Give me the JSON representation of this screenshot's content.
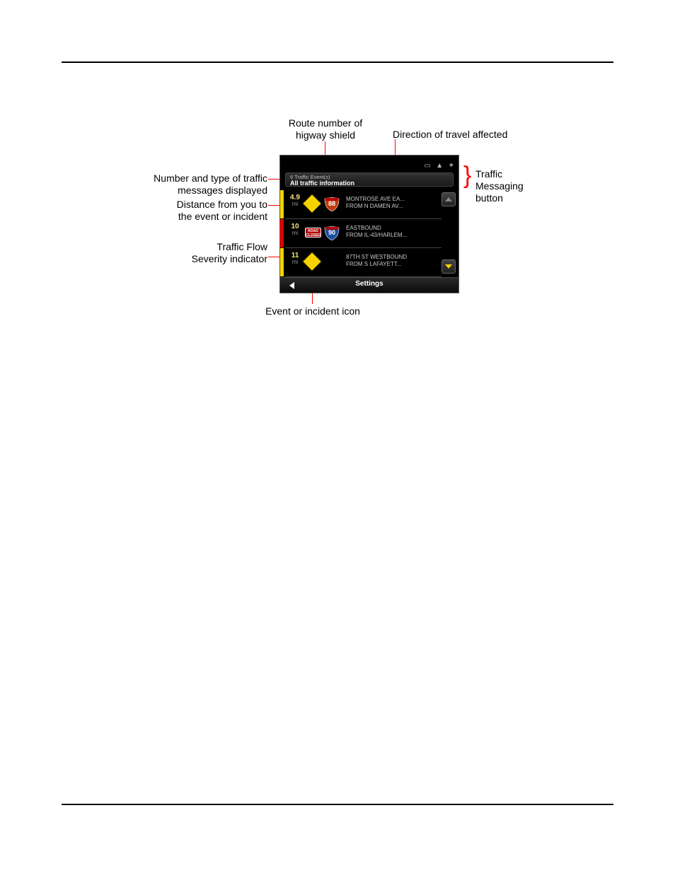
{
  "callouts": {
    "route_shield": "Route number of\nhigway shield",
    "direction": "Direction of travel affected",
    "traffic_button": "Traffic\nMessaging\nbutton",
    "num_type": "Number and type of traffic\nmessages displayed",
    "distance": "Distance from you to\nthe event or incident",
    "severity": "Traffic Flow\nSeverity indicator",
    "event_icon": "Event or incident icon"
  },
  "device": {
    "header_sub": "6 Traffic Event(s)",
    "header_main": "All traffic information",
    "settings": "Settings",
    "closed_label": "ROAD\nCLOSED",
    "rows": [
      {
        "severity": "yellow",
        "dist": "4.9",
        "unit": "mi",
        "icon": "diamond",
        "shield": "88",
        "shield_color": "#c23a0a",
        "line1": "MONTROSE AVE EA...",
        "line2": "FROM N DAMEN AV..."
      },
      {
        "severity": "red",
        "dist": "10",
        "unit": "mi",
        "icon": "closed",
        "shield": "90",
        "shield_color": "#1a4fa0",
        "line1": "EASTBOUND",
        "line2": "FROM IL-43/HARLEM..."
      },
      {
        "severity": "yellow",
        "dist": "11",
        "unit": "mi",
        "icon": "diamond",
        "shield": "",
        "shield_color": "",
        "line1": "87TH ST WESTBOUND",
        "line2": "FROM S LAFAYETT..."
      }
    ]
  }
}
